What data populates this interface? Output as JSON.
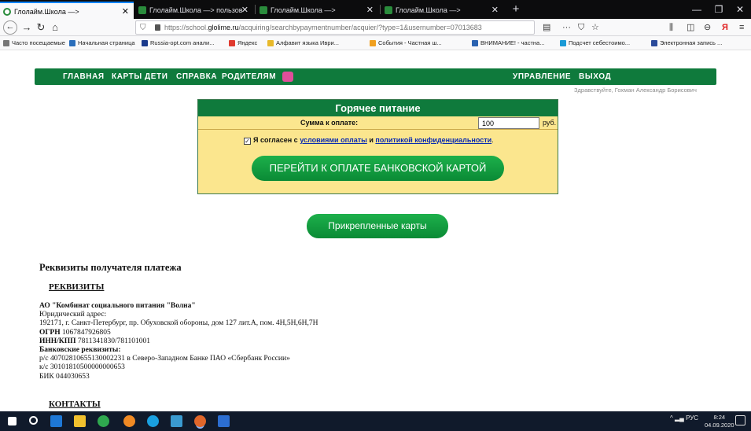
{
  "browser": {
    "tabs": [
      {
        "title": "Глолайм.Школа —>",
        "active": true
      },
      {
        "title": "Глолайм.Школа —> пользов",
        "active": false
      },
      {
        "title": "Глолайм.Школа —>",
        "active": false
      },
      {
        "title": "Глолайм.Школа —>",
        "active": false
      }
    ],
    "new_tab": "+",
    "url_prefix": "https://school.",
    "url_domain": "glolime.ru",
    "url_path": "/acquiring/searchbypaymentnumber/acquier/?type=1&usernumber=07013683",
    "menu_dots": "···",
    "accent": "#0a84ff"
  },
  "bookmarks": [
    {
      "label": "Часто посещаемые",
      "color": "#777777"
    },
    {
      "label": "Начальная страница",
      "color": "#2a6ebb"
    },
    {
      "label": "Russia-opt.com анали...",
      "color": "#1a3a8c"
    },
    {
      "label": "Яндекс",
      "color": "#e03a2f"
    },
    {
      "label": "Алфавит языка Иври...",
      "color": "#e8b92a"
    },
    {
      "label": "События - Частная ш...",
      "color": "#f0a020"
    },
    {
      "label": "ВНИМАНИЕ! - частна...",
      "color": "#2a62b0"
    },
    {
      "label": "Подсчет себестоимо...",
      "color": "#1a9ad6"
    },
    {
      "label": "Электронная запись ...",
      "color": "#2a4a9a"
    }
  ],
  "site_nav": {
    "left": [
      "ГЛАВНАЯ",
      "КАРТЫ",
      "ДЕТИ",
      "СПРАВКА",
      "РОДИТЕЛЯМ"
    ],
    "right": [
      "УПРАВЛЕНИЕ",
      "ВЫХОД"
    ],
    "bg_color": "#0f7a3c"
  },
  "greeting": "Здравствуйте, Гохман Александр Борисович",
  "payment": {
    "title": "Горячее питание",
    "amount_label": "Сумма к оплате:",
    "amount_value": "100",
    "currency": "руб.",
    "consent_prefix": "Я согласен с",
    "consent_link1": "условиями оплаты",
    "consent_and": "и",
    "consent_link2": "политикой конфиденциальности",
    "consent_end": ".",
    "consent_checked": true,
    "pay_button": "ПЕРЕЙТИ К ОПЛАТЕ БАНКОВСКОЙ КАРТОЙ",
    "box_color": "#fbe68e"
  },
  "attached_cards_button": "Прикрепленные карты",
  "requisites": {
    "title": "Реквизиты получателя платежа",
    "section_heading": "РЕКВИЗИТЫ",
    "company": "АО \"Комбинат социального питания \"Волна\"",
    "legal_address_label": "Юридический адрес:",
    "legal_address": "192171, г. Санкт-Петербург, пр. Обуховской обороны, дом 127 лит.А, пом. 4Н,5Н,6Н,7Н",
    "ogrn_label": "ОГРН",
    "ogrn": "1067847926805",
    "inn_label": "ИНН/КПП",
    "inn": "7811341830/781101001",
    "bank_label": "Банковские реквизиты:",
    "account": "р/с 40702810655130002231 в Северо-Западном Банке ПАО «Сбербанк России»",
    "corr_account": "к/с 30101810500000000653",
    "bik": "БИК 044030653",
    "contacts_heading": "КОНТАКТЫ"
  },
  "taskbar": {
    "lang": "РУС",
    "time": "8:24",
    "date": "04.09.2020"
  }
}
